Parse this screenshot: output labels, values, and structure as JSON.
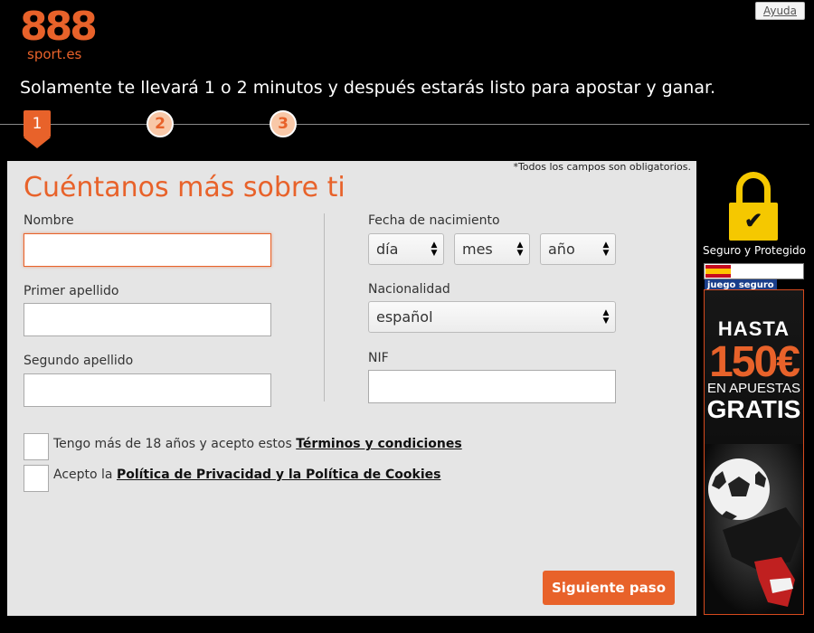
{
  "header": {
    "logo_number": "888",
    "logo_sub": "sport.es",
    "help_label": "Ayuda",
    "tagline": "Solamente te llevará 1 o 2 minutos y después estarás listo para apostar y ganar."
  },
  "steps": [
    "1",
    "2",
    "3"
  ],
  "form": {
    "required_note": "*Todos los campos son obligatorios.",
    "title": "Cuéntanos más sobre ti",
    "nombre_label": "Nombre",
    "primer_apellido_label": "Primer apellido",
    "segundo_apellido_label": "Segundo apellido",
    "fecha_label": "Fecha de nacimiento",
    "dia": "día",
    "mes": "mes",
    "anio": "año",
    "nacionalidad_label": "Nacionalidad",
    "nacionalidad_value": "español",
    "nif_label": "NIF",
    "terms_prefix": "Tengo más de 18 años y acepto estos ",
    "terms_link": "Términos y condiciones",
    "privacy_prefix": "Acepto la ",
    "privacy_link": "Política de Privacidad y la Política de Cookies",
    "next_button": "Siguiente paso"
  },
  "side": {
    "secure_text": "Seguro y Protegido",
    "juego_badge": "juego seguro",
    "promo_line1": "HASTA",
    "promo_amount": "150€",
    "promo_line2": "EN APUESTAS",
    "promo_line3": "GRATIS"
  },
  "colors": {
    "brand_orange": "#e8622a",
    "panel_bg": "#e5e5e5",
    "lock_yellow": "#f5c800"
  },
  "icons": {
    "lock": "lock-check-icon",
    "select_arrows": "up-down-arrows-icon"
  }
}
